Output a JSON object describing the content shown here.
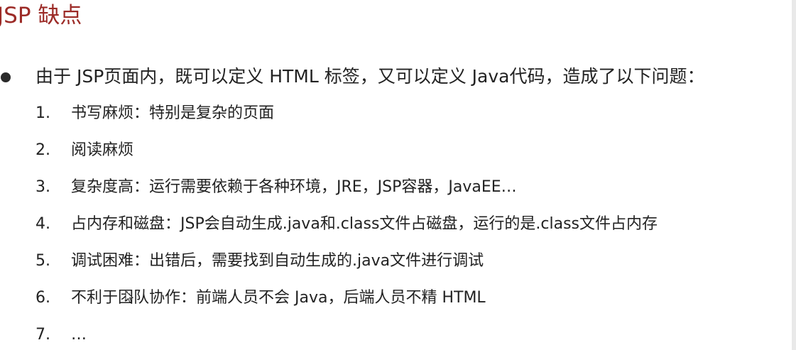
{
  "title": "JSP 缺点",
  "bullet": "由于 JSP页面内，既可以定义 HTML 标签，又可以定义 Java代码，造成了以下问题：",
  "items": [
    {
      "num": "1.",
      "text": "书写麻烦：特别是复杂的页面"
    },
    {
      "num": "2.",
      "text": "阅读麻烦"
    },
    {
      "num": "3.",
      "text": "复杂度高：运行需要依赖于各种环境，JRE，JSP容器，JavaEE…"
    },
    {
      "num": "4.",
      "text": "占内存和磁盘：JSP会自动生成.java和.class文件占磁盘，运行的是.class文件占内存"
    },
    {
      "num": "5.",
      "text": "调试困难：出错后，需要找到自动生成的.java文件进行调试"
    },
    {
      "num": "6.",
      "text": "不利于团队协作：前端人员不会 Java，后端人员不精 HTML"
    },
    {
      "num": "7.",
      "text": "…"
    }
  ],
  "colors": {
    "title": "#9c2b27",
    "text": "#222222"
  },
  "icons": {
    "cursor": "mouse-pointer-icon"
  }
}
